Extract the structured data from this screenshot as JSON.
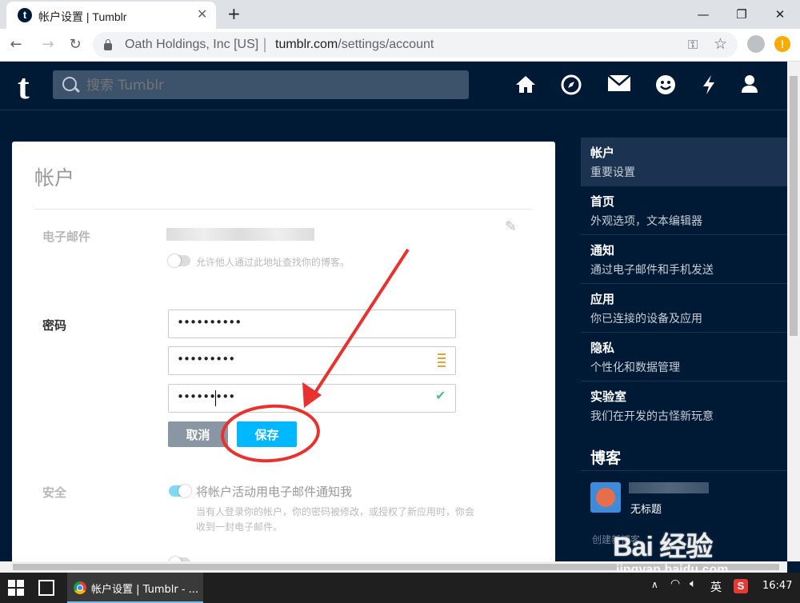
{
  "browser": {
    "tab_title": "帐户设置 | Tumblr",
    "tab_favicon": "t",
    "site_owner": "Oath Holdings, Inc [US]",
    "url_host": "tumblr.com",
    "url_path": "/settings/account"
  },
  "header": {
    "logo": "t",
    "search_placeholder": "搜索 Tumblr",
    "icons": [
      "home-icon",
      "compass-icon",
      "mail-icon",
      "chat-icon",
      "lightning-icon",
      "account-icon"
    ]
  },
  "account": {
    "title": "帐户",
    "email_label": "电子邮件",
    "email_lookup_text": "允许他人通过此地址查找你的博客。",
    "password_label": "密码",
    "password_current": "••••••••••",
    "password_new": "•••••••••",
    "password_confirm": "•••••••••",
    "cancel_label": "取消",
    "save_label": "保存",
    "security_label": "安全",
    "security_notify": "将帐户活动用电子邮件通知我",
    "security_desc": "当有人登录你的帐户，你的密码被修改，或授权了新应用时，你会收到一封电子邮件。"
  },
  "sidebar": {
    "items": [
      {
        "title": "帐户",
        "sub": "重要设置"
      },
      {
        "title": "首页",
        "sub": "外观选项，文本编辑器"
      },
      {
        "title": "通知",
        "sub": "通过电子邮件和手机发送"
      },
      {
        "title": "应用",
        "sub": "你已连接的设备及应用"
      },
      {
        "title": "隐私",
        "sub": "个性化和数据管理"
      },
      {
        "title": "实验室",
        "sub": "我们在开发的古怪新玩意"
      }
    ],
    "blogs_heading": "博客",
    "blog_untitled": "无标题",
    "create_blog": "创建新博客"
  },
  "watermark": {
    "logo": "Bai 经验",
    "domain": "jingyan.baidu.com"
  },
  "taskbar": {
    "app_label": "帐户设置 | Tumblr - ...",
    "ime": "英",
    "sogou": "S",
    "time": "16:47"
  },
  "colors": {
    "tumblr_navy": "#001935",
    "save_blue": "#00b8ff",
    "annotation_red": "#e8322f"
  }
}
